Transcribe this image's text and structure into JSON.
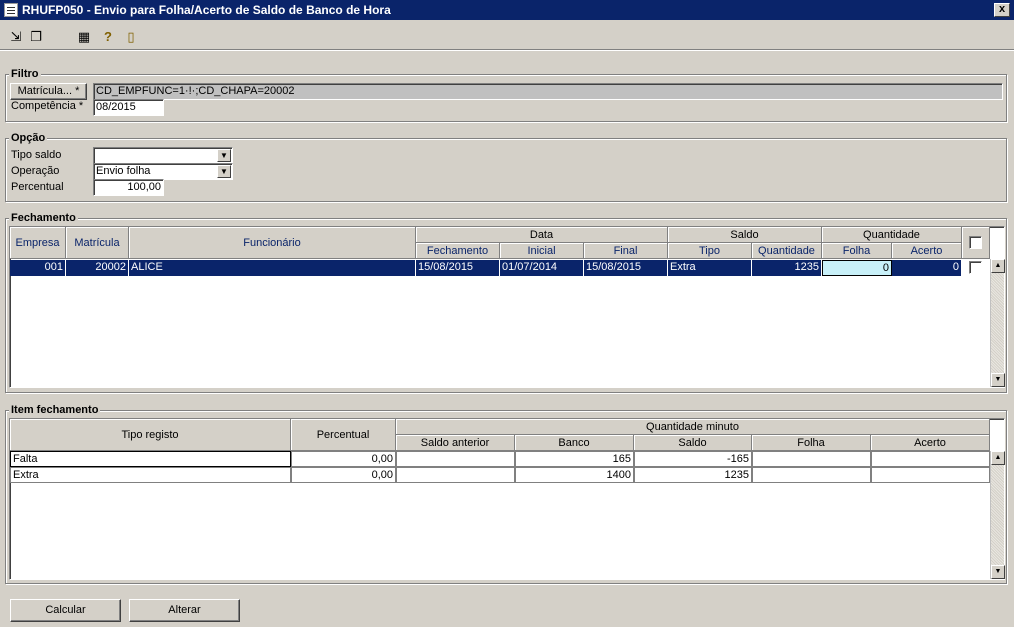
{
  "window": {
    "title": "RHUFP050 - Envio para Folha/Acerto de Saldo de Banco de Hora",
    "close_label": "x"
  },
  "toolbar": {
    "icons": [
      "export-icon",
      "copy-icon",
      "grid-icon",
      "help-icon",
      "exit-icon"
    ]
  },
  "filtro": {
    "title": "Filtro",
    "matricula_button": "Matrícula... *",
    "matricula_value": "CD_EMPFUNC=1·!·;CD_CHAPA=20002",
    "competencia_label": "Competência *",
    "competencia_value": "08/2015"
  },
  "opcao": {
    "title": "Opção",
    "tipo_saldo_label": "Tipo saldo",
    "tipo_saldo_value": "",
    "operacao_label": "Operação",
    "operacao_value": "Envio folha",
    "percentual_label": "Percentual",
    "percentual_value": "100,00"
  },
  "fechamento": {
    "title": "Fechamento",
    "headers": {
      "empresa": "Empresa",
      "matricula": "Matrícula",
      "funcionario": "Funcionário",
      "data": "Data",
      "fechamento": "Fechamento",
      "inicial": "Inicial",
      "final": "Final",
      "saldo": "Saldo",
      "tipo": "Tipo",
      "quantidade": "Quantidade",
      "quantidade_group": "Quantidade",
      "folha": "Folha",
      "acerto": "Acerto"
    },
    "rows": [
      {
        "empresa": "001",
        "matricula": "20002",
        "funcionario": "ALICE",
        "fechamento": "15/08/2015",
        "inicial": "01/07/2014",
        "final": "15/08/2015",
        "tipo": "Extra",
        "quantidade": "1235",
        "folha": "0",
        "acerto": "0"
      }
    ]
  },
  "item_fechamento": {
    "title": "Item fechamento",
    "headers": {
      "tipo_registo": "Tipo registo",
      "percentual": "Percentual",
      "quantidade_minuto": "Quantidade minuto",
      "saldo_anterior": "Saldo anterior",
      "banco": "Banco",
      "saldo": "Saldo",
      "folha": "Folha",
      "acerto": "Acerto"
    },
    "rows": [
      {
        "tipo_registo": "Falta",
        "percentual": "0,00",
        "saldo_anterior": "",
        "banco": "165",
        "saldo": "-165",
        "folha": "",
        "acerto": ""
      },
      {
        "tipo_registo": "Extra",
        "percentual": "0,00",
        "saldo_anterior": "",
        "banco": "1400",
        "saldo": "1235",
        "folha": "",
        "acerto": ""
      }
    ]
  },
  "buttons": {
    "calcular": "Calcular",
    "alterar": "Alterar"
  }
}
